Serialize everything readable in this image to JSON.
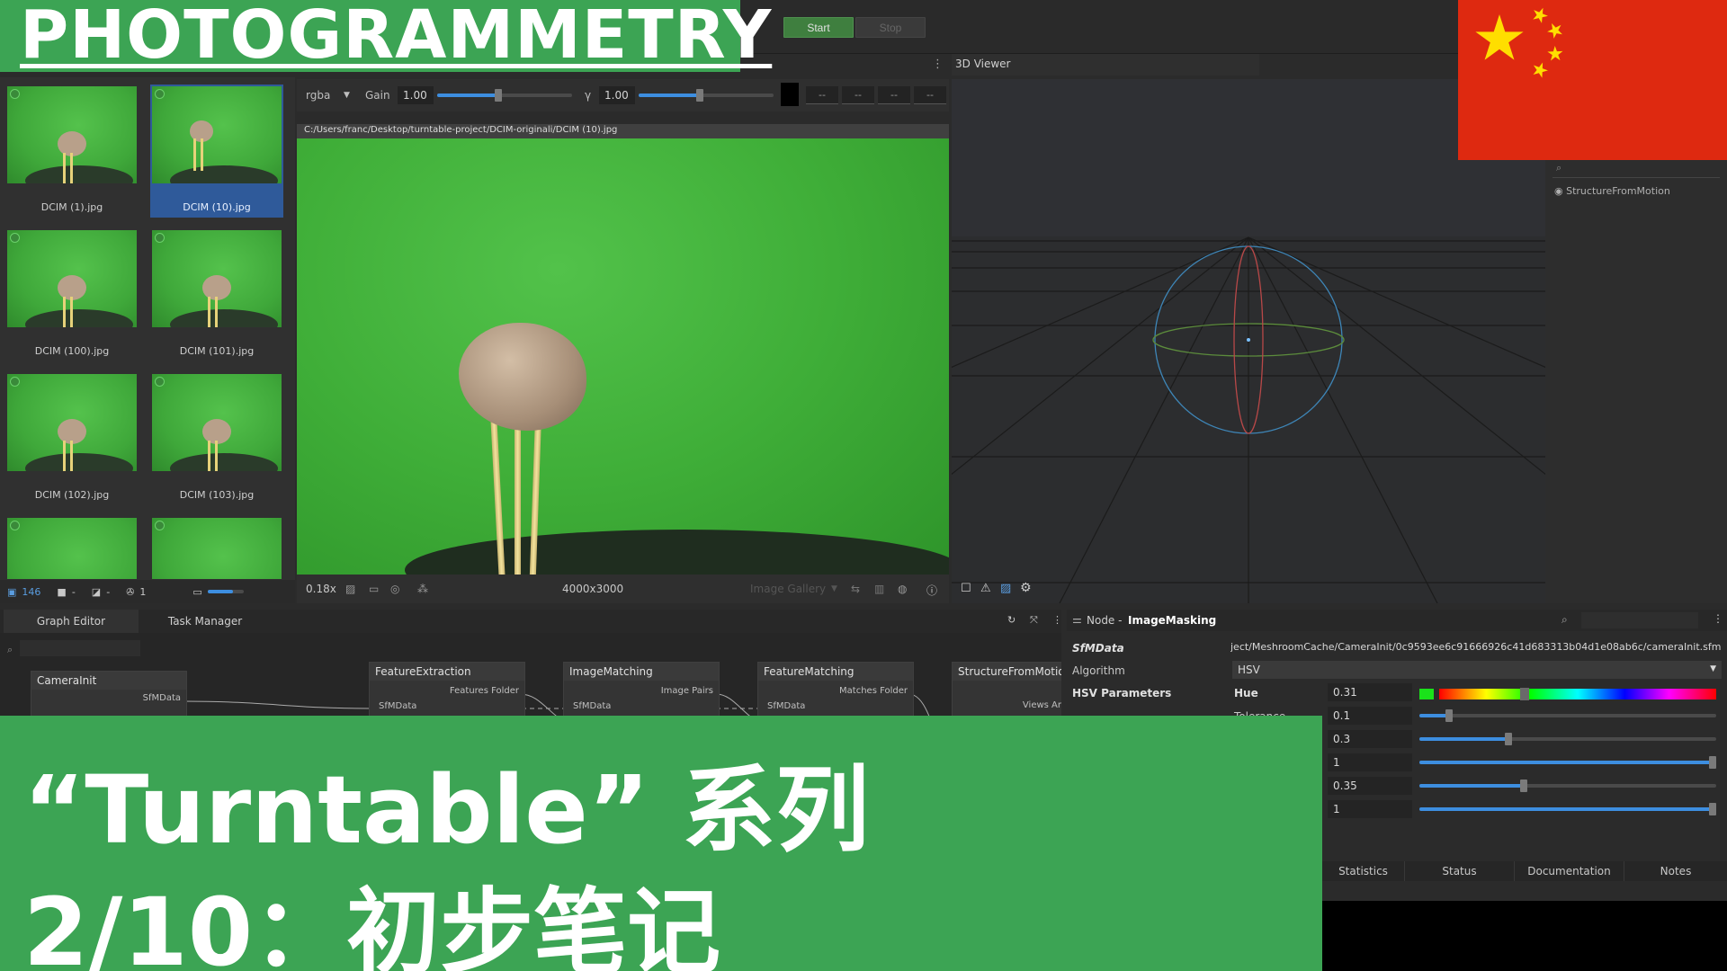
{
  "overlay": {
    "title": "PHOTOGRAMMETRY",
    "subtitle_line1": "“Turntable” 系列",
    "subtitle_line2": "2/10：初步笔记",
    "banner_color": "#3ca454",
    "flag_color": "#de2910",
    "flag_star_color": "#ffde00"
  },
  "toolbar": {
    "start_label": "Start",
    "stop_label": "Stop"
  },
  "gallery": {
    "items": [
      {
        "label": "DCIM (1).jpg",
        "selected": false
      },
      {
        "label": "DCIM (10).jpg",
        "selected": true
      },
      {
        "label": "DCIM (100).jpg",
        "selected": false
      },
      {
        "label": "DCIM (101).jpg",
        "selected": false
      },
      {
        "label": "DCIM (102).jpg",
        "selected": false
      },
      {
        "label": "DCIM (103).jpg",
        "selected": false
      },
      {
        "label": "",
        "selected": false
      },
      {
        "label": "",
        "selected": false
      }
    ],
    "footer": {
      "image_count": "146",
      "camera_dash": "-",
      "no_camera_dash": "-",
      "intrinsics_count": "1"
    }
  },
  "viewer2d": {
    "channel": "rgba",
    "gain_label": "Gain",
    "gain_value": "1.00",
    "gain_fraction": 0.45,
    "gamma_label": "γ",
    "gamma_value": "1.00",
    "gamma_fraction": 0.45,
    "pixel_fields": [
      "--",
      "--",
      "--",
      "--"
    ],
    "path": "C:/Users/franc/Desktop/turntable-project/DCIM-originali/DCIM (10).jpg",
    "zoom": "0.18x",
    "resolution": "4000x3000",
    "gallery_dropdown": "Image Gallery"
  },
  "viewer3d": {
    "title": "3D Viewer"
  },
  "outliner": {
    "items": [
      "StructureFromMotion"
    ]
  },
  "graph": {
    "tabs": [
      "Graph Editor",
      "Task Manager"
    ],
    "nodes": [
      {
        "title": "CameraInit",
        "out_port": "SfMData",
        "in_port": ""
      },
      {
        "title": "FeatureExtraction",
        "out_port": "Features Folder",
        "in_port": "SfMData"
      },
      {
        "title": "ImageMatching",
        "out_port": "Image Pairs",
        "in_port": "SfMData"
      },
      {
        "title": "FeatureMatching",
        "out_port": "Matches Folder",
        "in_port": "SfMData"
      },
      {
        "title": "StructureFromMotion",
        "out_port": "Views Ar",
        "in_port": ""
      }
    ]
  },
  "attributes": {
    "header_prefix": "Node - ",
    "node_name": "ImageMasking",
    "sfmdata_label": "SfMData",
    "sfmdata_value": "ject/MeshroomCache/CameraInit/0c9593ee6c91666926c41d683313b04d1e08ab6c/cameraInit.sfm",
    "algorithm_label": "Algorithm",
    "algorithm_value": "HSV",
    "group_label": "HSV Parameters",
    "hue_label": "Hue",
    "tolerance_label": "Tolerance",
    "params": [
      {
        "value": "0.31",
        "fraction": 0.31
      },
      {
        "value": "0.1",
        "fraction": 0.1
      },
      {
        "value": "0.3",
        "fraction": 0.3
      },
      {
        "value": "1",
        "fraction": 1.0
      },
      {
        "value": "0.35",
        "fraction": 0.35
      },
      {
        "value": "1",
        "fraction": 1.0
      }
    ],
    "bottom_tabs": [
      "Statistics",
      "Status",
      "Documentation",
      "Notes"
    ]
  }
}
